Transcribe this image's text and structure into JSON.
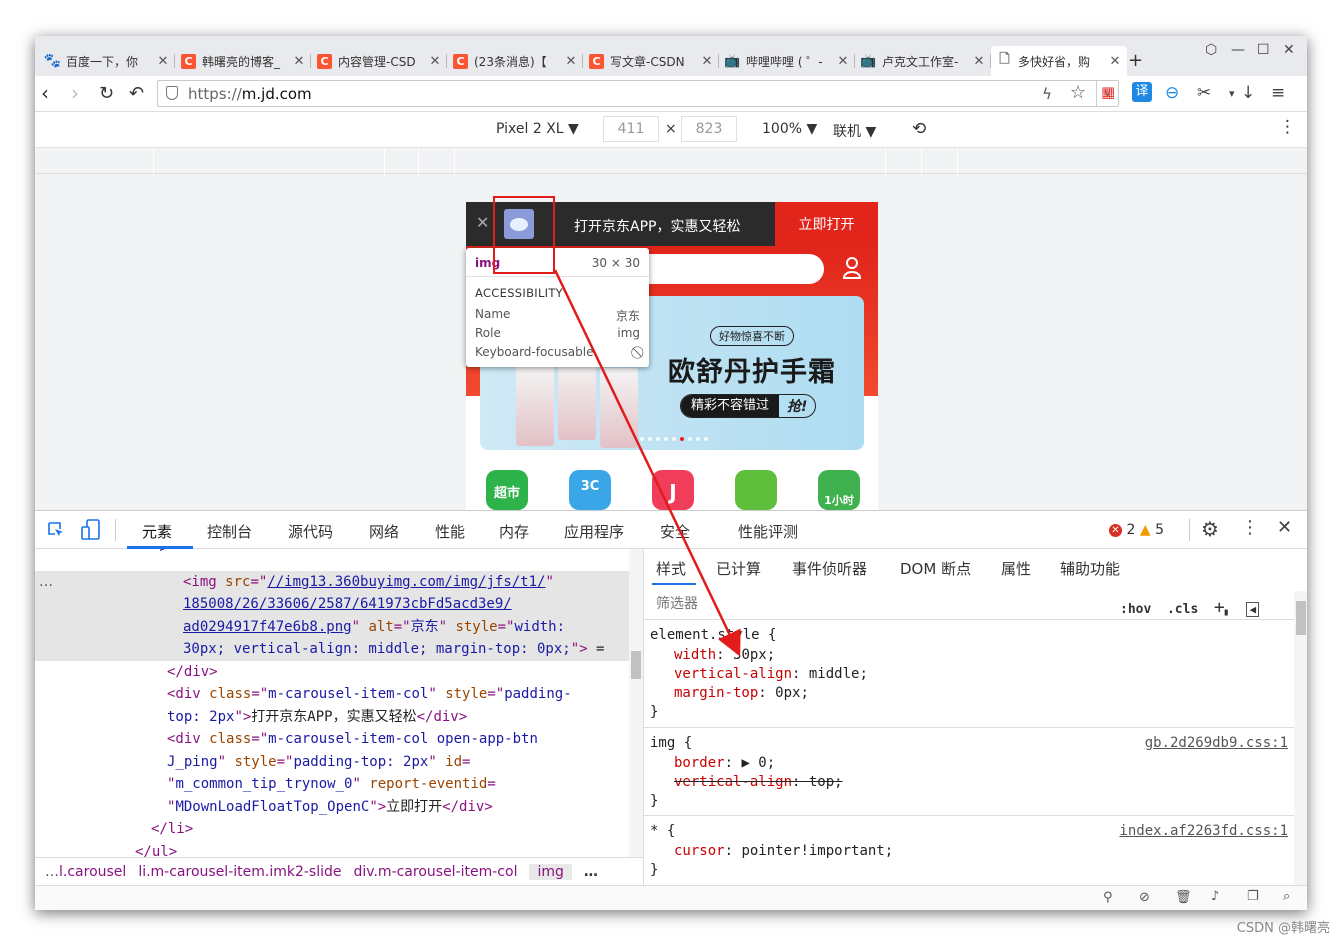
{
  "tabs": [
    {
      "icon": "baidu-icon",
      "title": "百度一下，你"
    },
    {
      "icon": "csdn-icon",
      "title": "韩曙亮的博客_"
    },
    {
      "icon": "csdn-icon",
      "title": "内容管理-CSD"
    },
    {
      "icon": "csdn-icon",
      "title": "(23条消息)【"
    },
    {
      "icon": "csdn-icon",
      "title": "写文章-CSDN"
    },
    {
      "icon": "bilibili-icon",
      "title": "哔哩哔哩 ( ゜-"
    },
    {
      "icon": "bilibili-icon",
      "title": "卢克文工作室-"
    },
    {
      "icon": "document-icon",
      "title": "多快好省，购"
    }
  ],
  "address": {
    "scheme": "https://",
    "host": "m.jd.com"
  },
  "device": {
    "name": "Pixel 2 XL",
    "width": "411",
    "height": "823",
    "zoom": "100%",
    "network": "联机"
  },
  "page": {
    "banner_text": "打开京东APP，实惠又轻松",
    "open_button": "立即打开",
    "tag": "好物惊喜不断",
    "headline": "欧舒丹护手霜",
    "pill_a": "精彩不容错过",
    "pill_b": "抢!",
    "categories": [
      "超市",
      "3C",
      "J",
      "",
      "1小时"
    ]
  },
  "tooltip": {
    "tag": "img",
    "size": "30 × 30",
    "section": "ACCESSIBILITY",
    "rows": [
      {
        "k": "Name",
        "v": "京东"
      },
      {
        "k": "Role",
        "v": "img"
      },
      {
        "k": "Keyboard-focusable",
        "v": "⃠"
      }
    ]
  },
  "devtools": {
    "tabs": [
      "元素",
      "控制台",
      "源代码",
      "网络",
      "性能",
      "内存",
      "应用程序",
      "安全",
      "性能评测"
    ],
    "errors": "2",
    "warnings": "5",
    "dom": {
      "l0": "\">",
      "img_url_1": "//img13.360buyimg.com/img/jfs/t1/",
      "img_url_2": "185008/26/33606/2587/641973cbFd5acd3e9/",
      "img_url_3": "ad0294917f47e6b8.png",
      "img_alt": "京东",
      "img_style_1": "width:",
      "img_style_2": "30px; vertical-align: middle; margin-top: 0px;",
      "div_text": "打开京东APP，实惠又轻松",
      "btn_id": "m_common_tip_trynow_0",
      "btn_event": "MDownLoadFloatTop_OpenC",
      "btn_text": "立即打开"
    },
    "breadcrumb": [
      "l.carousel",
      "li.m-carousel-item.imk2-slide",
      "div.m-carousel-item-col",
      "img"
    ],
    "styles_tabs": [
      "样式",
      "已计算",
      "事件侦听器",
      "DOM 断点",
      "属性",
      "辅助功能"
    ],
    "filter_placeholder": "筛选器",
    "rules": [
      {
        "selector": "element.style {",
        "props": [
          [
            "width",
            "30px"
          ],
          [
            "vertical-align",
            "middle"
          ],
          [
            "margin-top",
            "0px"
          ]
        ],
        "src": ""
      },
      {
        "selector": "img {",
        "props": [
          [
            "border",
            "▶ 0"
          ],
          [
            "vertical-align",
            "top"
          ]
        ],
        "src": "gb.2d269db9.css:1"
      },
      {
        "selector": "* {",
        "props": [
          [
            "cursor",
            "pointer!important"
          ]
        ],
        "src": "index.af2263fd.css:1"
      }
    ]
  },
  "watermark": "CSDN @韩曙亮"
}
